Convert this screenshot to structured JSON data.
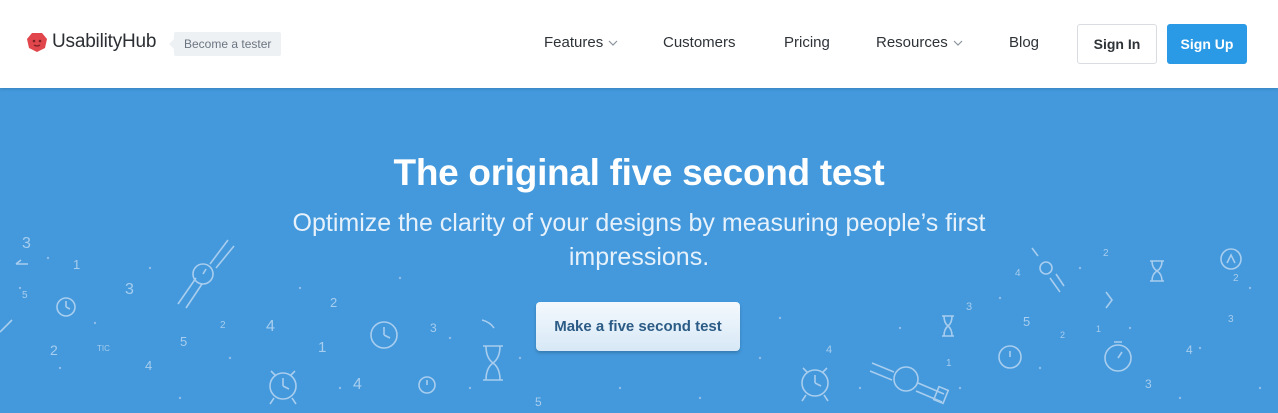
{
  "header": {
    "brand": "UsabilityHub",
    "tester_badge": "Become a tester",
    "nav": {
      "features": "Features",
      "customers": "Customers",
      "pricing": "Pricing",
      "resources": "Resources",
      "blog": "Blog"
    },
    "sign_in": "Sign In",
    "sign_up": "Sign Up"
  },
  "hero": {
    "title": "The original five second test",
    "subtitle": "Optimize the clarity of your designs by measuring people’s first impressions.",
    "cta": "Make a five second test"
  },
  "colors": {
    "hero_bg": "#4399dc",
    "brand_red": "#e0464b",
    "signup_blue": "#2b9ae6",
    "cta_text": "#2c5c86"
  },
  "icons": [
    "usabilityhub-logo-icon",
    "chevron-down-icon",
    "watch-icon",
    "clock-icon",
    "hourglass-icon",
    "alarm-clock-icon",
    "stopwatch-icon"
  ]
}
